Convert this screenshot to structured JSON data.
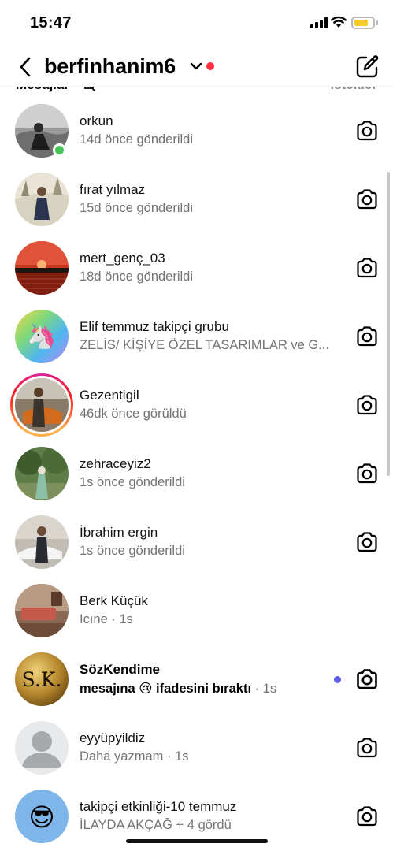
{
  "status_bar": {
    "time": "15:47"
  },
  "header": {
    "title": "berfinhanim6"
  },
  "section": {
    "label": "Mesajlar",
    "requests": "İstekler"
  },
  "conversations": [
    {
      "name": "orkun",
      "subtitle": "14d önce gönderildi",
      "online": true
    },
    {
      "name": "fırat yılmaz",
      "subtitle": "15d önce gönderildi"
    },
    {
      "name": "mert_genç_03",
      "subtitle": "18d önce gönderildi"
    },
    {
      "name": "Elif temmuz takipçi grubu",
      "subtitle": "ZELİS/ KİŞİYE ÖZEL TASARIMLAR ve G..."
    },
    {
      "name": "Gezentigil",
      "subtitle": "46dk önce görüldü",
      "story": true
    },
    {
      "name": "zehraceyiz2",
      "subtitle": "1s önce gönderildi"
    },
    {
      "name": "İbrahim ergin",
      "subtitle": "1s önce gönderildi"
    },
    {
      "name": "Berk Küçük",
      "subtitle": "Icıne",
      "time": "· 1s"
    },
    {
      "name": "SözKendime",
      "subtitle": "mesajına 😢 ifadesini bıraktı",
      "time": "· 1s",
      "unread": true,
      "avatar_text": "S.K."
    },
    {
      "name": "eyyüpyildiz",
      "subtitle": "Daha yazmam",
      "time": "· 1s"
    },
    {
      "name": "takipçi etkinliği-10 temmuz",
      "subtitle": "İLAYDA AKÇAĞ + 4 gördü",
      "avatar_emoji": "😎"
    }
  ],
  "icons": {
    "back": "chevron-left-icon",
    "compose": "new-message-icon",
    "camera": "camera-icon",
    "mute": "mute-bell-icon"
  },
  "colors": {
    "online": "#44c654",
    "unread": "#5b5fe8",
    "notification": "#ff3040",
    "battery": "#f6cc2c"
  }
}
